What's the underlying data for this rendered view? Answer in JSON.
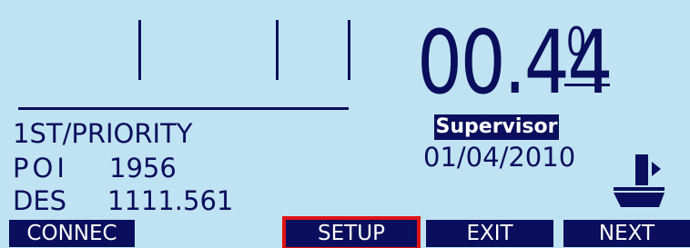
{
  "display": {
    "value_main": "00.44",
    "value_superscript": "0",
    "role_badge": "Supervisor",
    "date": "01/04/2010"
  },
  "info": {
    "priority_line": "1ST/PRIORITY",
    "poi_label": "POI",
    "poi_value": "1956",
    "des_label": "DES",
    "des_value": "1111.561"
  },
  "softkeys": {
    "connect": "CONNEC",
    "setup": "SETUP",
    "exit": "EXIT",
    "next": "NEXT",
    "selected": "SETUP"
  },
  "icons": {
    "vessel": "boat-icon"
  },
  "colors": {
    "background": "#bfe3f2",
    "foreground": "#0a0e5c",
    "selection": "#e01414"
  }
}
